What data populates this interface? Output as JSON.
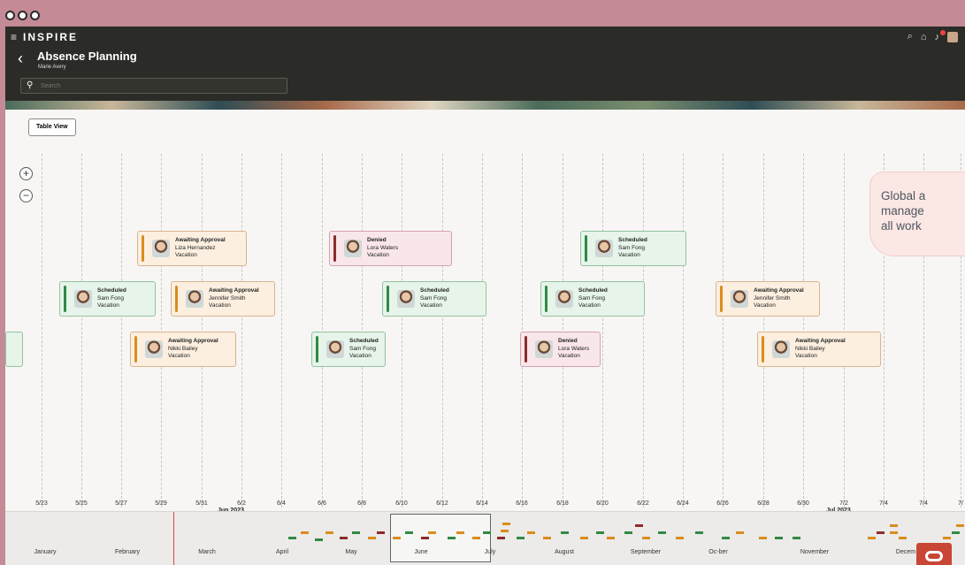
{
  "header": {
    "brand": "INSPIRE",
    "title": "Absence Planning",
    "subtitle": "Marie Avery",
    "search_placeholder": "Search"
  },
  "toolbar": {
    "table_view_label": "Table View"
  },
  "zoom": {
    "in": "+",
    "out": "−"
  },
  "timeline": {
    "date_labels": [
      "5/23",
      "5/25",
      "5/27",
      "5/29",
      "5/31",
      "6/2",
      "6/4",
      "6/6",
      "6/8",
      "6/10",
      "6/12",
      "6/14",
      "6/16",
      "6/18",
      "6/20",
      "6/22",
      "6/24",
      "6/26",
      "6/28",
      "6/30",
      "7/2",
      "7/4",
      "7/4",
      "7/"
    ],
    "month_labels": [
      "Jun 2023",
      "Jul 2023"
    ]
  },
  "cards": [
    {
      "status": "Awaiting Approval",
      "name": "Liza Hernandez",
      "type": "Vacation",
      "kind": "approval"
    },
    {
      "status": "Denied",
      "name": "Lora Waters",
      "type": "Vacation",
      "kind": "denied"
    },
    {
      "status": "Scheduled",
      "name": "Sam Fong",
      "type": "Vacation",
      "kind": "scheduled"
    },
    {
      "status": "Scheduled",
      "name": "Sam Fong",
      "type": "Vacation",
      "kind": "scheduled"
    },
    {
      "status": "Awaiting Approval",
      "name": "Jennifer Smith",
      "type": "Vacation",
      "kind": "approval"
    },
    {
      "status": "Scheduled",
      "name": "Sam Fong",
      "type": "Vacation",
      "kind": "scheduled"
    },
    {
      "status": "Scheduled",
      "name": "Sam Fong",
      "type": "Vacation",
      "kind": "scheduled"
    },
    {
      "status": "Awaiting Approval",
      "name": "Jennifer Smith",
      "type": "Vacation",
      "kind": "approval"
    },
    {
      "status": "Awaiting Approval",
      "name": "Nikki Bailey",
      "type": "Vacation",
      "kind": "approval"
    },
    {
      "status": "Scheduled",
      "name": "Sam Fong",
      "type": "Vacation",
      "kind": "scheduled"
    },
    {
      "status": "Denied",
      "name": "Lora Waters",
      "type": "Vacation",
      "kind": "denied"
    },
    {
      "status": "Awaiting Approval",
      "name": "Nikki Bailey",
      "type": "Vacation",
      "kind": "approval"
    }
  ],
  "callout": {
    "line1": "Global a",
    "line2": "manage",
    "line3": "all work"
  },
  "overview": {
    "months": [
      "January",
      "February",
      "March",
      "April",
      "May",
      "June",
      "July",
      "August",
      "September",
      "Oc-ber",
      "November",
      "Decem"
    ]
  },
  "colors": {
    "approval": "#d98c1e",
    "scheduled": "#2f8a45",
    "denied": "#8b2c2c"
  }
}
